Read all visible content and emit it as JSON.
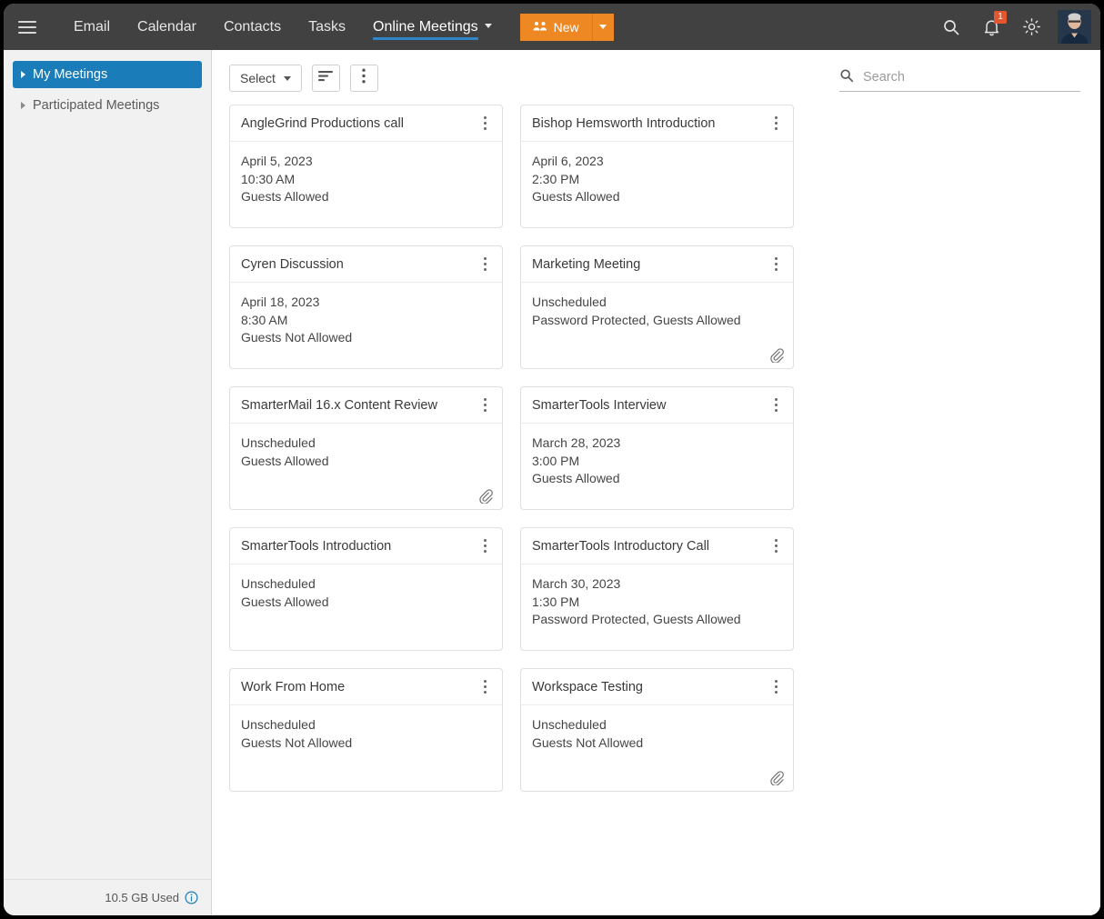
{
  "header": {
    "menu_icon": "hamburger-icon",
    "tabs": [
      {
        "label": "Email",
        "active": false,
        "has_caret": false
      },
      {
        "label": "Calendar",
        "active": false,
        "has_caret": false
      },
      {
        "label": "Contacts",
        "active": false,
        "has_caret": false
      },
      {
        "label": "Tasks",
        "active": false,
        "has_caret": false
      },
      {
        "label": "Online Meetings",
        "active": true,
        "has_caret": true
      }
    ],
    "new_button": {
      "label": "New",
      "icon": "people-group-icon",
      "color": "#ee8822"
    },
    "search_icon": "search-icon",
    "notifications": {
      "icon": "bell-icon",
      "count": "1",
      "badge_color": "#e4572e"
    },
    "theme_icon": "sun-icon",
    "avatar": "user-avatar"
  },
  "sidebar": {
    "items": [
      {
        "label": "My Meetings",
        "selected": true
      },
      {
        "label": "Participated Meetings",
        "selected": false
      }
    ],
    "storage": {
      "label": "10.5 GB Used",
      "info_icon": "info-icon",
      "info_color": "#1a7cb8"
    }
  },
  "toolbar": {
    "select_label": "Select",
    "sort_icon": "sort-icon",
    "more_icon": "more-vertical-icon"
  },
  "search": {
    "placeholder": "Search",
    "value": "",
    "icon": "search-icon"
  },
  "meetings": [
    {
      "title": "AngleGrind Productions call",
      "lines": [
        "April 5, 2023",
        "10:30 AM",
        "Guests Allowed"
      ],
      "attachment": false
    },
    {
      "title": "Bishop Hemsworth Introduction",
      "lines": [
        "April 6, 2023",
        "2:30 PM",
        "Guests Allowed"
      ],
      "attachment": false
    },
    {
      "title": "Cyren Discussion",
      "lines": [
        "April 18, 2023",
        "8:30 AM",
        "Guests Not Allowed"
      ],
      "attachment": false
    },
    {
      "title": "Marketing Meeting",
      "lines": [
        "Unscheduled",
        "Password Protected, Guests Allowed"
      ],
      "attachment": true
    },
    {
      "title": "SmarterMail 16.x Content Review",
      "lines": [
        "Unscheduled",
        "Guests Allowed"
      ],
      "attachment": true
    },
    {
      "title": "SmarterTools Interview",
      "lines": [
        "March 28, 2023",
        "3:00 PM",
        "Guests Allowed"
      ],
      "attachment": false
    },
    {
      "title": "SmarterTools Introduction",
      "lines": [
        "Unscheduled",
        "Guests Allowed"
      ],
      "attachment": false
    },
    {
      "title": "SmarterTools Introductory Call",
      "lines": [
        "March 30, 2023",
        "1:30 PM",
        "Password Protected, Guests Allowed"
      ],
      "attachment": false
    },
    {
      "title": "Work From Home",
      "lines": [
        "Unscheduled",
        "Guests Not Allowed"
      ],
      "attachment": false
    },
    {
      "title": "Workspace Testing",
      "lines": [
        "Unscheduled",
        "Guests Not Allowed"
      ],
      "attachment": true
    }
  ],
  "colors": {
    "header_bg": "#414141",
    "accent_blue": "#1a7cb8",
    "tab_underline": "#2e86c8",
    "orange": "#ee8822",
    "sidebar_bg": "#f1f1f1"
  }
}
